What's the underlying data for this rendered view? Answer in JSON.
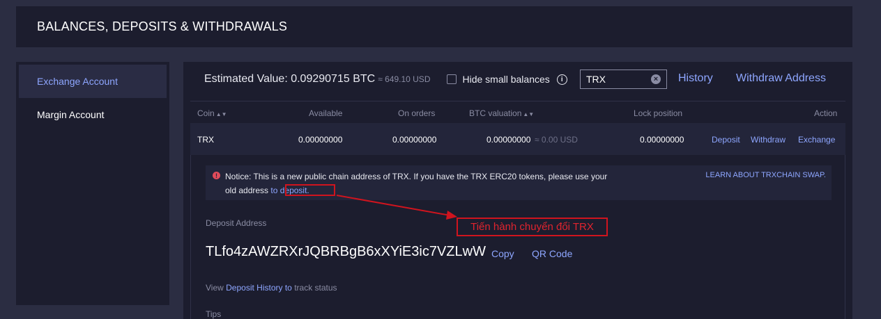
{
  "header": {
    "title": "BALANCES, DEPOSITS & WITHDRAWALS"
  },
  "sidebar": {
    "items": [
      {
        "label": "Exchange Account",
        "active": true
      },
      {
        "label": "Margin Account",
        "active": false
      }
    ]
  },
  "topbar": {
    "estimated_label": "Estimated Value: 0.09290715 BTC",
    "estimated_approx": "≈ 649.10 USD",
    "hide_small_label": "Hide small balances",
    "search_value": "TRX",
    "history_link": "History",
    "withdraw_address_link": "Withdraw Address"
  },
  "table": {
    "headers": {
      "coin": "Coin",
      "available": "Available",
      "on_orders": "On orders",
      "btc_valuation": "BTC valuation",
      "lock_position": "Lock position",
      "action": "Action"
    },
    "row": {
      "coin": "TRX",
      "available": "0.00000000",
      "on_orders": "0.00000000",
      "btc_valuation": "0.00000000",
      "usd_approx": "≈ 0.00 USD",
      "lock_position": "0.00000000",
      "actions": {
        "deposit": "Deposit",
        "withdraw": "Withdraw",
        "exchange": "Exchange"
      }
    }
  },
  "deposit": {
    "notice_text": "Notice: This is a new public chain address of TRX. If you have the TRX ERC20 tokens, please use your old address",
    "notice_link": "to deposit.",
    "learn_link": "LEARN ABOUT TRXCHAIN SWAP.",
    "address_label": "Deposit Address",
    "address": "TLfo4zAWZRXrJQBRBgB6xXYiE3ic7VZLwW",
    "copy_label": "Copy",
    "qr_label": "QR Code",
    "history_prefix": "View",
    "history_link": "Deposit History to",
    "history_suffix": "track status",
    "tips_label": "Tips"
  },
  "annotation": {
    "text": "Tiến hành chuyển đổi TRX"
  },
  "colors": {
    "accent": "#8ea6ff",
    "annotation": "#d0141e",
    "panel": "#1c1d2e",
    "background": "#2b2d42"
  },
  "icons": [
    "info-icon",
    "clear-icon",
    "sort-icon",
    "alert-icon",
    "arrow-icon"
  ]
}
